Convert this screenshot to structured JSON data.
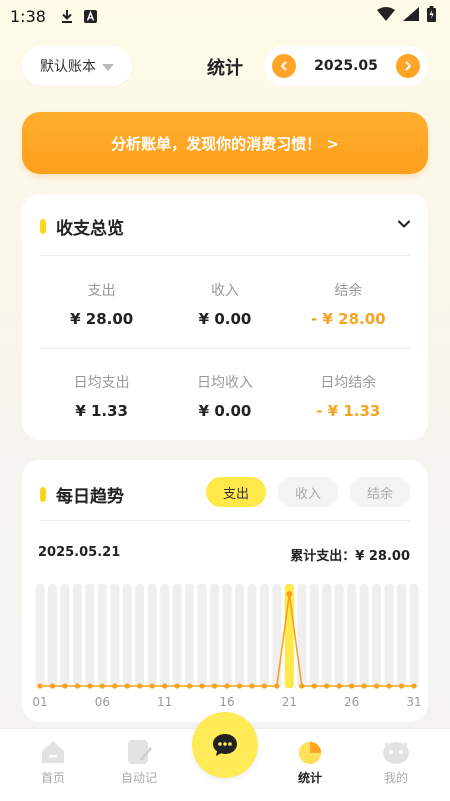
{
  "status_bar": {
    "time": "1:38"
  },
  "header": {
    "ledger_name": "默认账本",
    "title": "统计",
    "month": "2025.05"
  },
  "banner": {
    "text": "分析账单，发现你的消费习惯！ >"
  },
  "overview": {
    "title": "收支总览",
    "row1": [
      {
        "label": "支出",
        "value": "¥ 28.00",
        "tone": "normal"
      },
      {
        "label": "收入",
        "value": "¥ 0.00",
        "tone": "normal"
      },
      {
        "label": "结余",
        "value": "- ¥ 28.00",
        "tone": "orange"
      }
    ],
    "row2": [
      {
        "label": "日均支出",
        "value": "¥ 1.33",
        "tone": "normal"
      },
      {
        "label": "日均收入",
        "value": "¥ 0.00",
        "tone": "normal"
      },
      {
        "label": "日均结余",
        "value": "- ¥ 1.33",
        "tone": "orange"
      }
    ]
  },
  "trend": {
    "title": "每日趋势",
    "tabs": [
      "支出",
      "收入",
      "结余"
    ],
    "active_tab": "支出",
    "selected_date": "2025.05.21",
    "total_text": "累计支出：¥ 28.00"
  },
  "chart_data": {
    "type": "line",
    "x": [
      "01",
      "02",
      "03",
      "04",
      "05",
      "06",
      "07",
      "08",
      "09",
      "10",
      "11",
      "12",
      "13",
      "14",
      "15",
      "16",
      "17",
      "18",
      "19",
      "20",
      "21",
      "22",
      "23",
      "24",
      "25",
      "26",
      "27",
      "28",
      "29",
      "30",
      "31"
    ],
    "x_tick_labels": [
      "01",
      "06",
      "11",
      "16",
      "21",
      "26",
      "31"
    ],
    "series": [
      {
        "values": [
          0,
          0,
          0,
          0,
          0,
          0,
          0,
          0,
          0,
          0,
          0,
          0,
          0,
          0,
          0,
          0,
          0,
          0,
          0,
          0,
          28,
          0,
          0,
          0,
          0,
          0,
          0,
          0,
          0,
          0,
          0
        ]
      }
    ],
    "highlight_index": 20,
    "colors": {
      "line": "#f5a320",
      "bar": "#efefef",
      "highlight_bar": "#ffe94a"
    }
  },
  "tabbar": {
    "items": [
      {
        "label": "首页",
        "icon": "home-icon",
        "active": false
      },
      {
        "label": "自动记",
        "icon": "auto-record-icon",
        "active": false
      },
      {
        "label": "统计",
        "icon": "stats-icon",
        "active": true
      },
      {
        "label": "我的",
        "icon": "profile-icon",
        "active": false
      }
    ],
    "center_icon": "chat-bubble-icon"
  },
  "colors": {
    "accent": "#ffa528",
    "yellow": "#ffe94a",
    "orange_text": "#f5a320"
  }
}
